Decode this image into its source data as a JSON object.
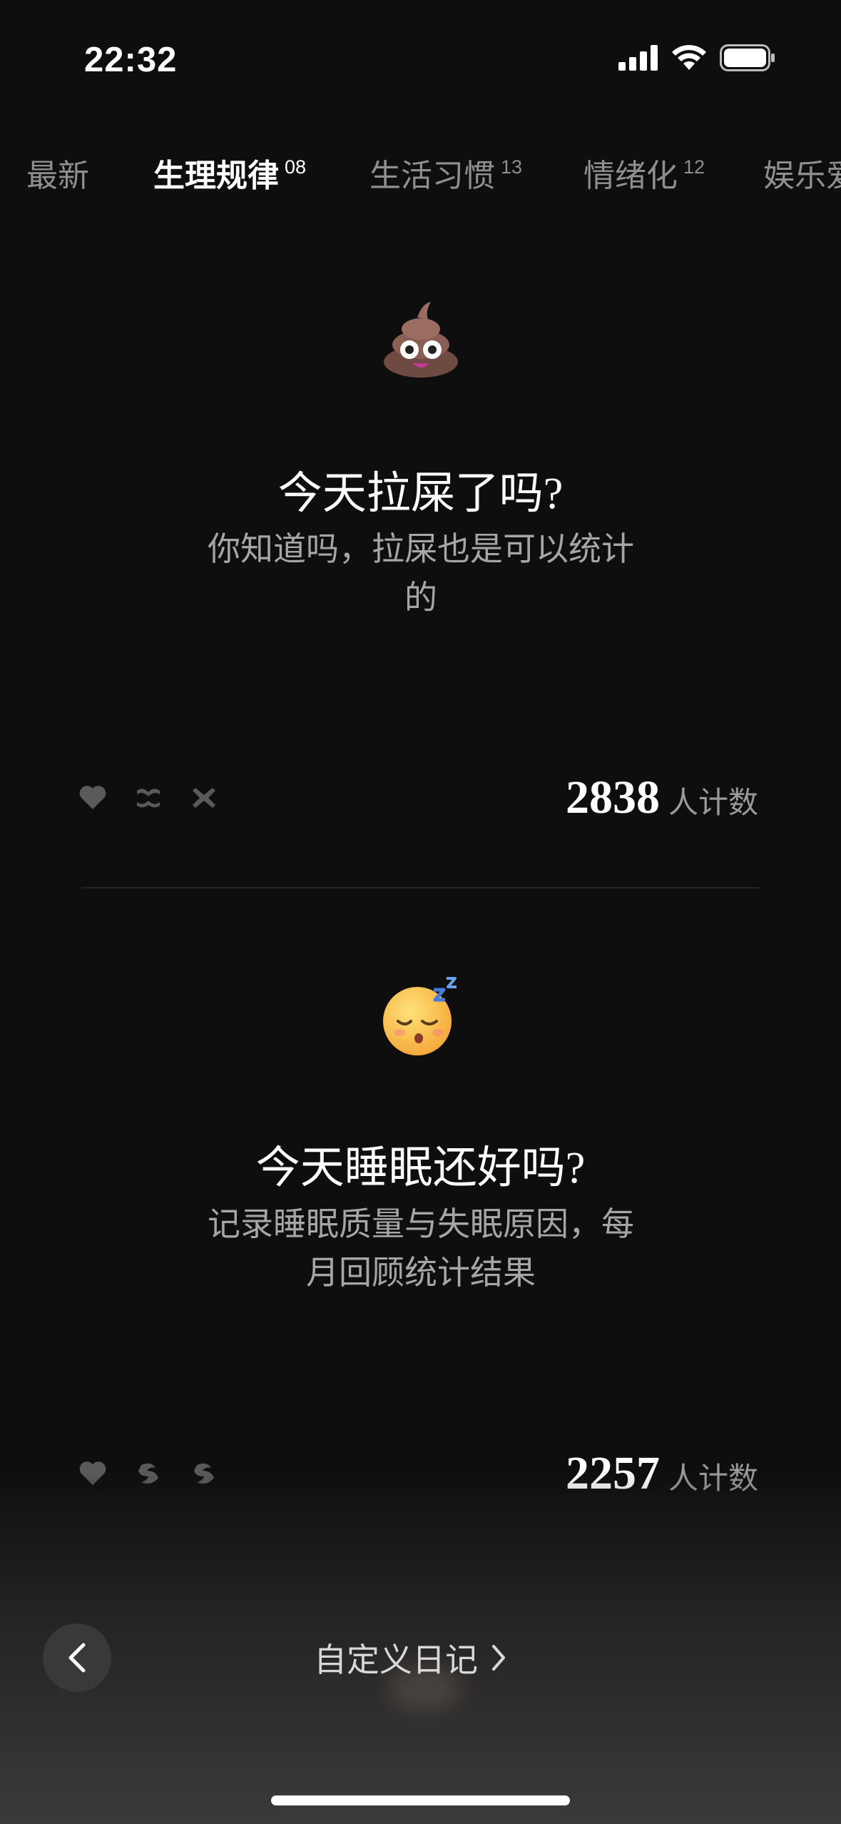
{
  "status_bar": {
    "time": "22:32"
  },
  "tabs": [
    {
      "label": "最新",
      "count": ""
    },
    {
      "label": "生理规律",
      "count": "08"
    },
    {
      "label": "生活习惯",
      "count": "13"
    },
    {
      "label": "情绪化",
      "count": "12"
    },
    {
      "label": "娱乐爱",
      "count": ""
    }
  ],
  "cards": [
    {
      "emoji": "poop",
      "title": "今天拉屎了吗?",
      "desc_line1": "你知道吗，拉屎也是可以统计",
      "desc_line2": "的",
      "count": "2838",
      "count_unit": "人计数"
    },
    {
      "emoji": "sleeping-face",
      "title": "今天睡眠还好吗?",
      "desc_line1": "记录睡眠质量与失眠原因，每",
      "desc_line2": "月回顾统计结果",
      "count": "2257",
      "count_unit": "人计数"
    }
  ],
  "bottom": {
    "custom_label": "自定义日记"
  },
  "colors": {
    "background": "#0f0e0e",
    "text_primary": "#ffffff",
    "text_secondary": "#a6a6a6",
    "tab_inactive": "#8f8f8f"
  }
}
